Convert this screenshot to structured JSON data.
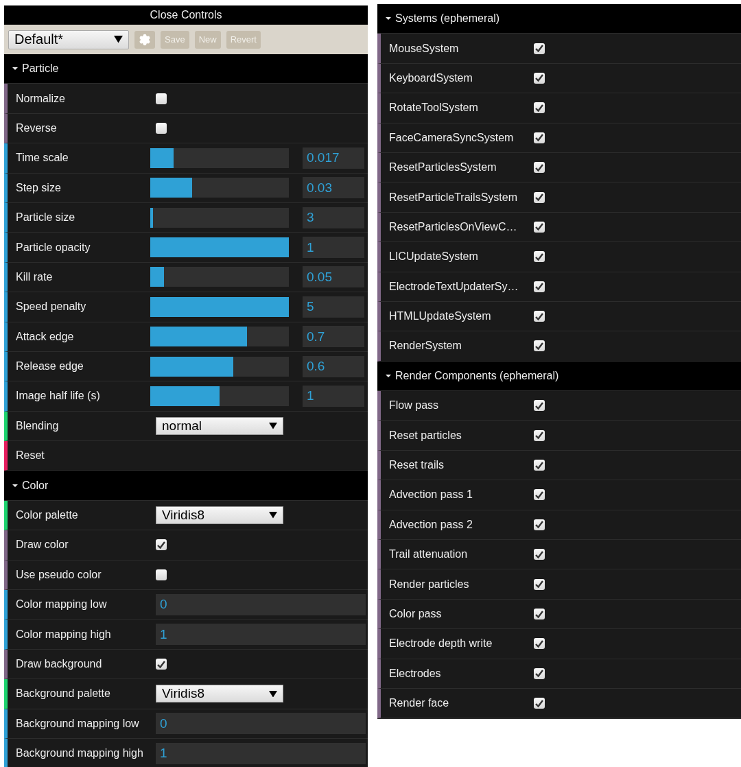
{
  "title": "Close Controls",
  "presets": {
    "value": "Default*",
    "buttons": [
      "Save",
      "New",
      "Revert"
    ]
  },
  "left_sections": [
    {
      "title": "Particle",
      "expanded": true,
      "items": [
        {
          "kind": "checkbox",
          "label": "Normalize",
          "checked": false
        },
        {
          "kind": "checkbox",
          "label": "Reverse",
          "checked": false
        },
        {
          "kind": "slider",
          "label": "Time scale",
          "level": 0.17,
          "value": "0.017"
        },
        {
          "kind": "slider",
          "label": "Step size",
          "level": 0.3,
          "value": "0.03"
        },
        {
          "kind": "slider",
          "label": "Particle size",
          "level": 0.02,
          "value": "3"
        },
        {
          "kind": "slider",
          "label": "Particle opacity",
          "level": 1,
          "value": "1"
        },
        {
          "kind": "slider",
          "label": "Kill rate",
          "level": 0.1,
          "value": "0.05"
        },
        {
          "kind": "slider",
          "label": "Speed penalty",
          "level": 1,
          "value": "5"
        },
        {
          "kind": "slider",
          "label": "Attack edge",
          "level": 0.7,
          "value": "0.7"
        },
        {
          "kind": "slider",
          "label": "Release edge",
          "level": 0.6,
          "value": "0.6"
        },
        {
          "kind": "slider",
          "label": "Image half life (s)",
          "level": 0.5,
          "value": "1"
        },
        {
          "kind": "select",
          "label": "Blending",
          "value": "normal"
        },
        {
          "kind": "button",
          "label": "Reset"
        }
      ]
    },
    {
      "title": "Color",
      "expanded": true,
      "items": [
        {
          "kind": "select",
          "label": "Color palette",
          "value": "Viridis8"
        },
        {
          "kind": "checkbox",
          "label": "Draw color",
          "checked": true
        },
        {
          "kind": "checkbox",
          "label": "Use pseudo color",
          "checked": false
        },
        {
          "kind": "number",
          "label": "Color mapping low",
          "value": "0"
        },
        {
          "kind": "number",
          "label": "Color mapping high",
          "value": "1"
        },
        {
          "kind": "checkbox",
          "label": "Draw background",
          "checked": true
        },
        {
          "kind": "select",
          "label": "Background palette",
          "value": "Viridis8"
        },
        {
          "kind": "number",
          "label": "Background mapping low",
          "value": "0"
        },
        {
          "kind": "number",
          "label": "Background mapping high",
          "value": "1"
        }
      ]
    }
  ],
  "right_sections": [
    {
      "title": "Systems (ephemeral)",
      "expanded": true,
      "items": [
        {
          "kind": "checkbox",
          "label": "MouseSystem",
          "checked": true
        },
        {
          "kind": "checkbox",
          "label": "KeyboardSystem",
          "checked": true
        },
        {
          "kind": "checkbox",
          "label": "RotateToolSystem",
          "checked": true
        },
        {
          "kind": "checkbox",
          "label": "FaceCameraSyncSystem",
          "checked": true
        },
        {
          "kind": "checkbox",
          "label": "ResetParticlesSystem",
          "checked": true
        },
        {
          "kind": "checkbox",
          "label": "ResetParticleTrailsSystem",
          "checked": true
        },
        {
          "kind": "checkbox",
          "label": "ResetParticlesOnViewC…",
          "checked": true
        },
        {
          "kind": "checkbox",
          "label": "LICUpdateSystem",
          "checked": true
        },
        {
          "kind": "checkbox",
          "label": "ElectrodeTextUpdaterSy…",
          "checked": true
        },
        {
          "kind": "checkbox",
          "label": "HTMLUpdateSystem",
          "checked": true
        },
        {
          "kind": "checkbox",
          "label": "RenderSystem",
          "checked": true
        }
      ]
    },
    {
      "title": "Render Components (ephemeral)",
      "expanded": true,
      "items": [
        {
          "kind": "checkbox",
          "label": "Flow pass",
          "checked": true
        },
        {
          "kind": "checkbox",
          "label": "Reset particles",
          "checked": true
        },
        {
          "kind": "checkbox",
          "label": "Reset trails",
          "checked": true
        },
        {
          "kind": "checkbox",
          "label": "Advection pass 1",
          "checked": true
        },
        {
          "kind": "checkbox",
          "label": "Advection pass 2",
          "checked": true
        },
        {
          "kind": "checkbox",
          "label": "Trail attenuation",
          "checked": true
        },
        {
          "kind": "checkbox",
          "label": "Render particles",
          "checked": true
        },
        {
          "kind": "checkbox",
          "label": "Color pass",
          "checked": true
        },
        {
          "kind": "checkbox",
          "label": "Electrode depth write",
          "checked": true
        },
        {
          "kind": "checkbox",
          "label": "Electrodes",
          "checked": true
        },
        {
          "kind": "checkbox",
          "label": "Render face",
          "checked": true
        }
      ]
    }
  ]
}
